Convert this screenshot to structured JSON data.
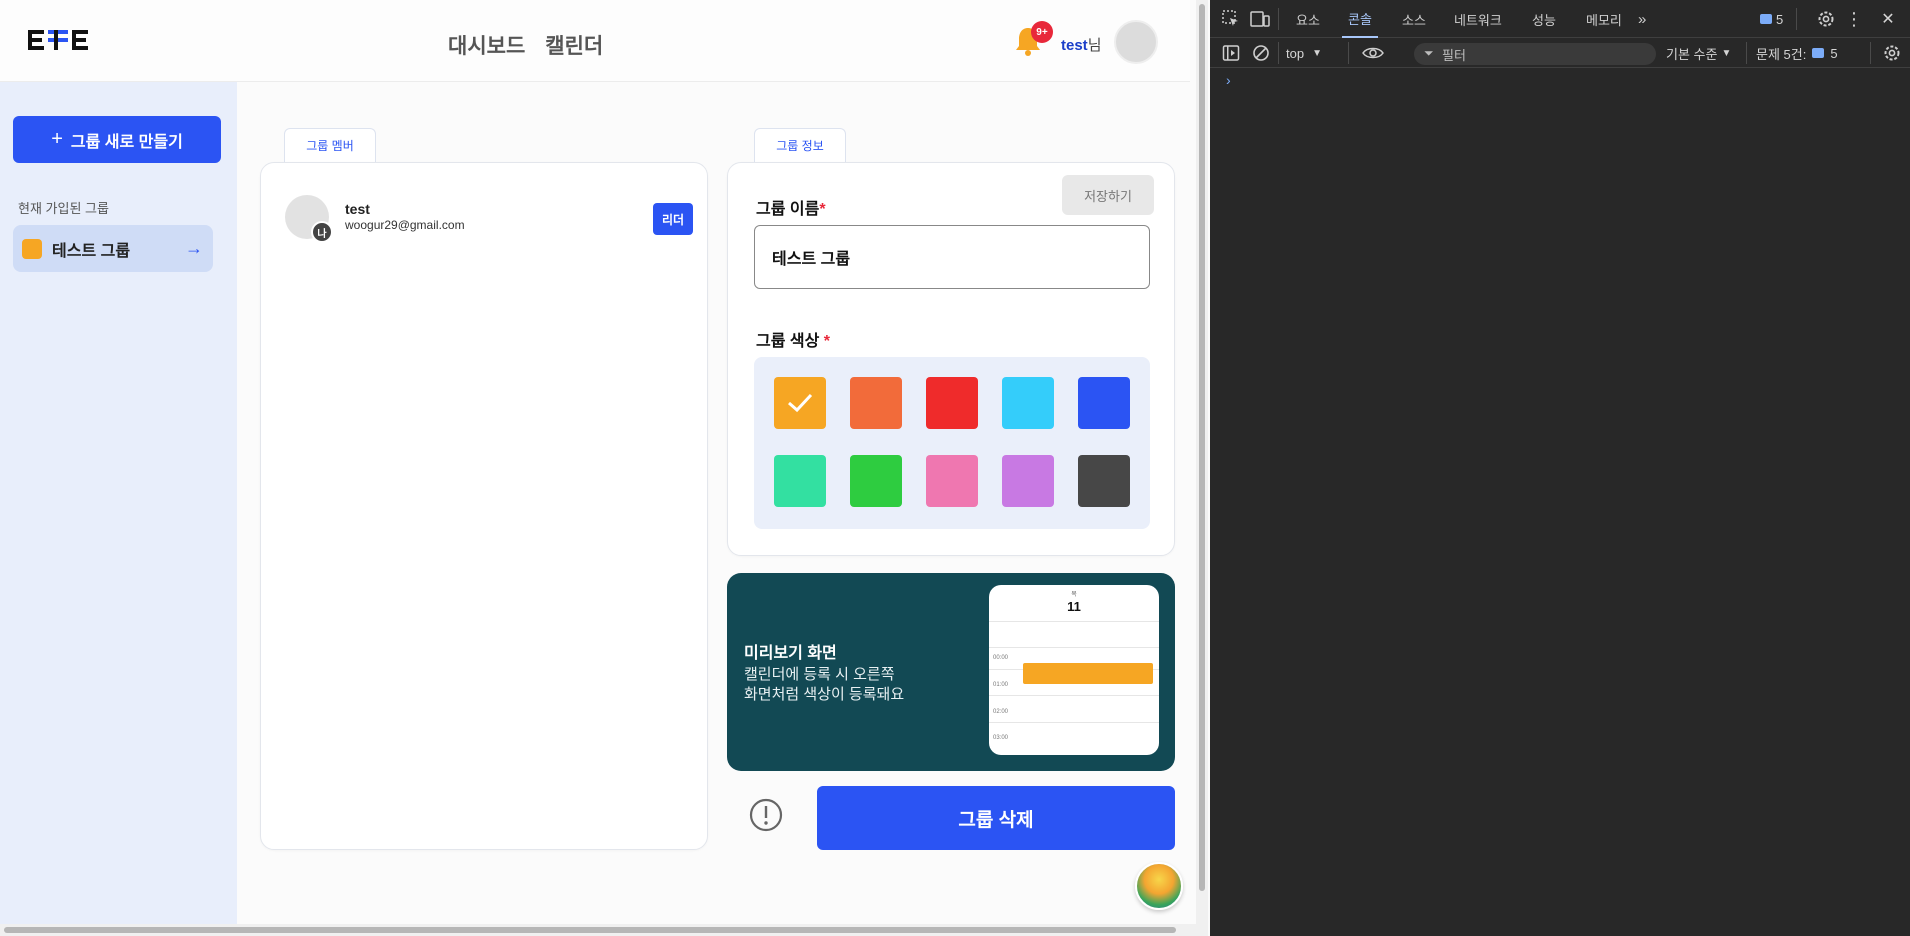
{
  "header": {
    "logo_text": "EFE",
    "nav": [
      "대시보드",
      "캘린더"
    ],
    "notification_count": "9+",
    "username": "test",
    "username_suffix": "님"
  },
  "sidebar": {
    "new_group_label": "그룹 새로 만들기",
    "caption": "현재 가입된 그룹",
    "groups": [
      {
        "label": "테스트 그룹",
        "color": "#f6a623"
      }
    ]
  },
  "members_panel": {
    "tab_label": "그룹 멤버",
    "members": [
      {
        "name": "test",
        "email": "woogur29@gmail.com",
        "avatar_badge": "나",
        "role": "리더"
      }
    ]
  },
  "info_panel": {
    "tab_label": "그룹 정보",
    "save_label": "저장하기",
    "name_label": "그룹 이름",
    "required_mark": "*",
    "name_value": "테스트 그룹",
    "color_label": "그룹 색상",
    "colors": [
      "#f6a623",
      "#f26b3a",
      "#ef2b2b",
      "#34cdfa",
      "#2b54f3",
      "#33e0a1",
      "#2ecc40",
      "#ef77b0",
      "#c879e3",
      "#474747"
    ],
    "selected_color_index": 0
  },
  "preview": {
    "title": "미리보기 화면",
    "desc_line1": "캘린더에 등록 시 오른쪽",
    "desc_line2": "화면처럼 색상이 등록돼요",
    "day_label": "목",
    "date": "11",
    "times": [
      "00:00",
      "01:00",
      "02:00",
      "03:00"
    ]
  },
  "actions": {
    "delete_label": "그룹 삭제"
  },
  "devtools": {
    "tabs": [
      "요소",
      "콘솔",
      "소스",
      "네트워크",
      "성능",
      "메모리"
    ],
    "active_tab": "콘솔",
    "issues_badge": "5",
    "context": "top",
    "filter_placeholder": "필터",
    "level": "기본 수준",
    "issues_label": "문제 5건:",
    "issues_count": "5",
    "prompt": "›"
  }
}
